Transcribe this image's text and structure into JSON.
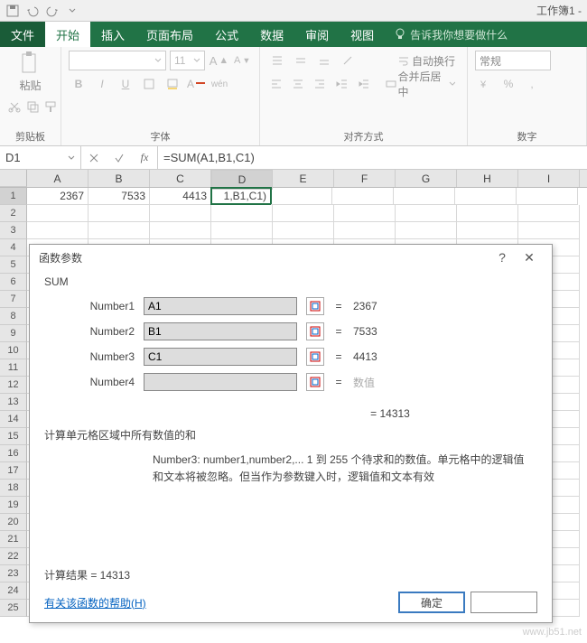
{
  "titlebar": {
    "workbook": "工作簿1 -"
  },
  "tabs": {
    "file": "文件",
    "home": "开始",
    "insert": "插入",
    "layout": "页面布局",
    "formula": "公式",
    "data": "数据",
    "review": "审阅",
    "view": "视图",
    "tellme": "告诉我你想要做什么"
  },
  "ribbon": {
    "clipboard": {
      "paste": "粘贴",
      "label": "剪贴板"
    },
    "font": {
      "size": "11",
      "label": "字体",
      "bold": "B",
      "italic": "I",
      "underline": "U"
    },
    "align": {
      "wrap": "自动换行",
      "merge": "合并后居中",
      "label": "对齐方式"
    },
    "number": {
      "general": "常规",
      "label": "数字"
    }
  },
  "formula_bar": {
    "name": "D1",
    "formula": "=SUM(A1,B1,C1)",
    "fx": "fx"
  },
  "grid": {
    "cols": [
      "A",
      "B",
      "C",
      "D",
      "E",
      "F",
      "G",
      "H",
      "I"
    ],
    "rows": [
      "1",
      "2",
      "3",
      "4",
      "5",
      "6",
      "7",
      "8",
      "9",
      "10",
      "11",
      "12",
      "13",
      "14",
      "15",
      "16",
      "17",
      "18",
      "19",
      "20",
      "21",
      "22",
      "23",
      "24",
      "25"
    ],
    "data": {
      "A1": "2367",
      "B1": "7533",
      "C1": "4413",
      "D1": "1,B1,C1)"
    },
    "active": "D1"
  },
  "dialog": {
    "title": "函数参数",
    "fn": "SUM",
    "args": [
      {
        "label": "Number1",
        "value": "A1",
        "result": "2367"
      },
      {
        "label": "Number2",
        "value": "B1",
        "result": "7533"
      },
      {
        "label": "Number3",
        "value": "C1",
        "result": "4413"
      },
      {
        "label": "Number4",
        "value": "",
        "result": "数值",
        "placeholder": true
      }
    ],
    "total_eq": "=  14313",
    "desc1": "计算单元格区域中所有数值的和",
    "desc2a": "Number3:  number1,number2,...  1 到 255 个待求和的数值。单元格中的逻辑值",
    "desc2b": "和文本将被忽略。但当作为参数键入时，逻辑值和文本有效",
    "result_label": "计算结果 =  14313",
    "help": "有关该函数的帮助(H)",
    "ok": "确定"
  },
  "watermark": "www.jb51.net"
}
